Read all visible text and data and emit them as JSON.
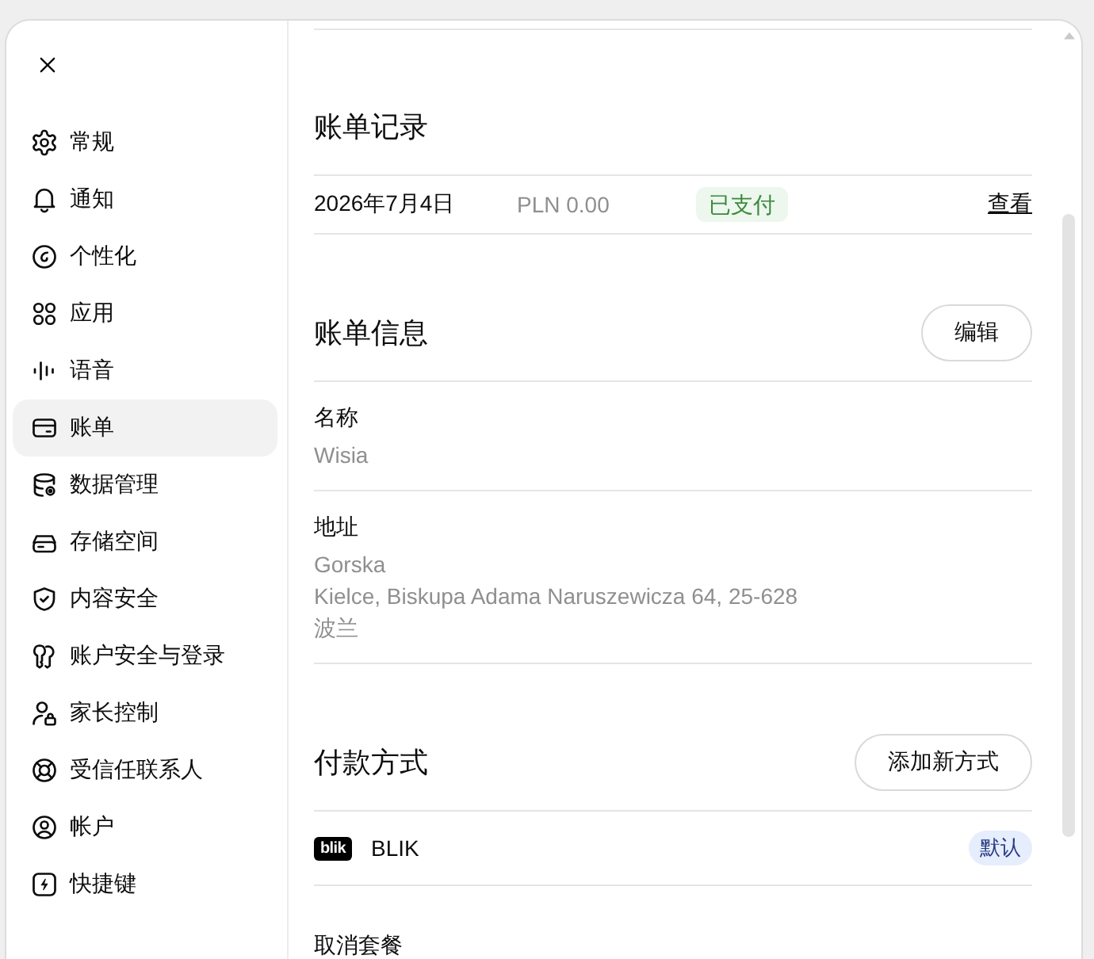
{
  "sidebar": {
    "items": [
      {
        "label": "常规",
        "selected": false
      },
      {
        "label": "通知",
        "selected": false
      },
      {
        "label": "个性化",
        "selected": false
      },
      {
        "label": "应用",
        "selected": false
      },
      {
        "label": "语音",
        "selected": false
      },
      {
        "label": "账单",
        "selected": true
      },
      {
        "label": "数据管理",
        "selected": false
      },
      {
        "label": "存储空间",
        "selected": false
      },
      {
        "label": "内容安全",
        "selected": false
      },
      {
        "label": "账户安全与登录",
        "selected": false
      },
      {
        "label": "家长控制",
        "selected": false
      },
      {
        "label": "受信任联系人",
        "selected": false
      },
      {
        "label": "帐户",
        "selected": false
      },
      {
        "label": "快捷键",
        "selected": false
      }
    ]
  },
  "billing_history": {
    "title": "账单记录",
    "rows": [
      {
        "date": "2026年7月4日",
        "amount": "PLN 0.00",
        "status": "已支付",
        "action": "查看"
      }
    ]
  },
  "billing_info": {
    "title": "账单信息",
    "edit_button": "编辑",
    "fields": [
      {
        "label": "名称",
        "lines": [
          "Wisia"
        ]
      },
      {
        "label": "地址",
        "lines": [
          "Gorska",
          "Kielce, Biskupa Adama Naruszewicza 64, 25-628",
          "波兰"
        ]
      }
    ]
  },
  "payment_methods": {
    "title": "付款方式",
    "add_button": "添加新方式",
    "methods": [
      {
        "logo_text": "blik",
        "name": "BLIK",
        "badge": "默认"
      }
    ]
  },
  "cancel_plan": {
    "title": "取消套餐"
  }
}
